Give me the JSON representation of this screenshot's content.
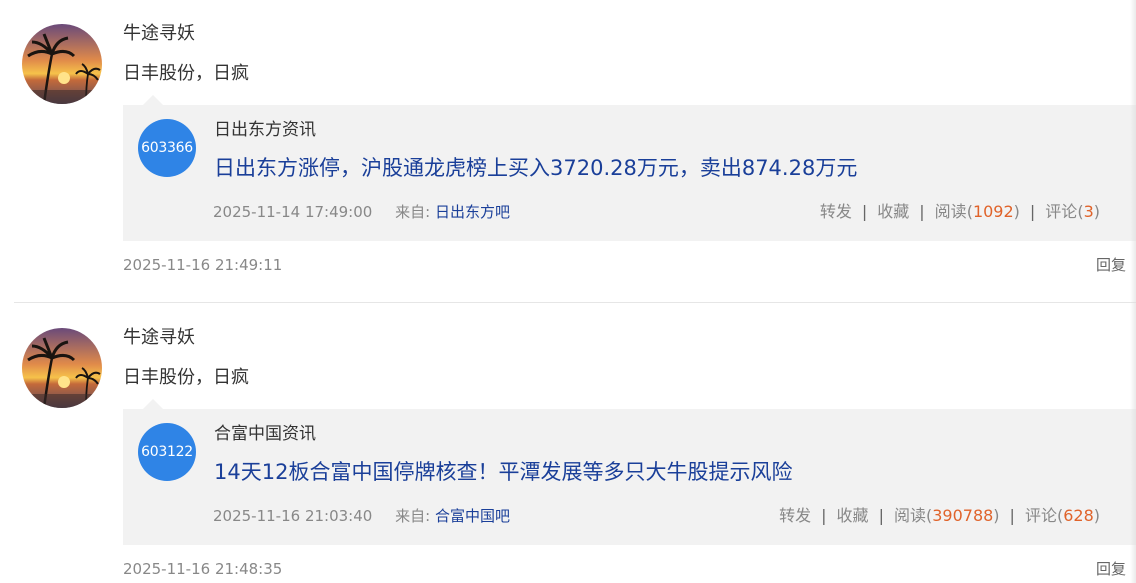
{
  "posts": [
    {
      "username": "牛途寻妖",
      "text": "日丰股份，日疯",
      "card": {
        "stock_code": "603366",
        "source_name": "日出东方资讯",
        "headline": "日出东方涨停，沪股通龙虎榜上买入3720.28万元，卖出874.28万元",
        "time": "2025-11-14 17:49:00",
        "from_label": "来自:",
        "from_link": "日出东方吧",
        "forward_label": "转发",
        "favorite_label": "收藏",
        "read_label": "阅读",
        "read_count": "1092",
        "comment_label": "评论",
        "comment_count": "3"
      },
      "time": "2025-11-16 21:49:11",
      "reply_label": "回复"
    },
    {
      "username": "牛途寻妖",
      "text": "日丰股份，日疯",
      "card": {
        "stock_code": "603122",
        "source_name": "合富中国资讯",
        "headline": "14天12板合富中国停牌核查！平潭发展等多只大牛股提示风险",
        "time": "2025-11-16 21:03:40",
        "from_label": "来自:",
        "from_link": "合富中国吧",
        "forward_label": "转发",
        "favorite_label": "收藏",
        "read_label": "阅读",
        "read_count": "390788",
        "comment_label": "评论",
        "comment_count": "628"
      },
      "time": "2025-11-16 21:48:35",
      "reply_label": "回复"
    }
  ],
  "colors": {
    "link": "#1a3f99",
    "badge": "#2f84e6",
    "count": "#e0632a",
    "card_bg": "#f2f2f2"
  }
}
